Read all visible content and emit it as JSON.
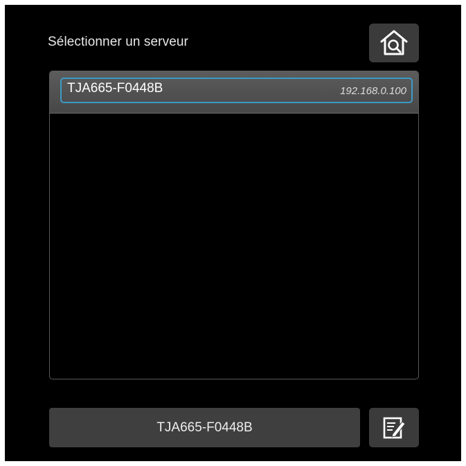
{
  "dialog": {
    "title": "Sélectionner un serveur"
  },
  "toolbar": {
    "scan_icon": "house-search-icon",
    "edit_icon": "edit-note-icon"
  },
  "servers": [
    {
      "name": "TJA665-F0448B",
      "ip": "192.168.0.100",
      "selected": true
    }
  ],
  "selected_server": {
    "value": "TJA665-F0448B"
  },
  "colors": {
    "background": "#000000",
    "row": "#4f4f4f",
    "focus": "#3d9bc6",
    "button": "#3b3b3b"
  }
}
